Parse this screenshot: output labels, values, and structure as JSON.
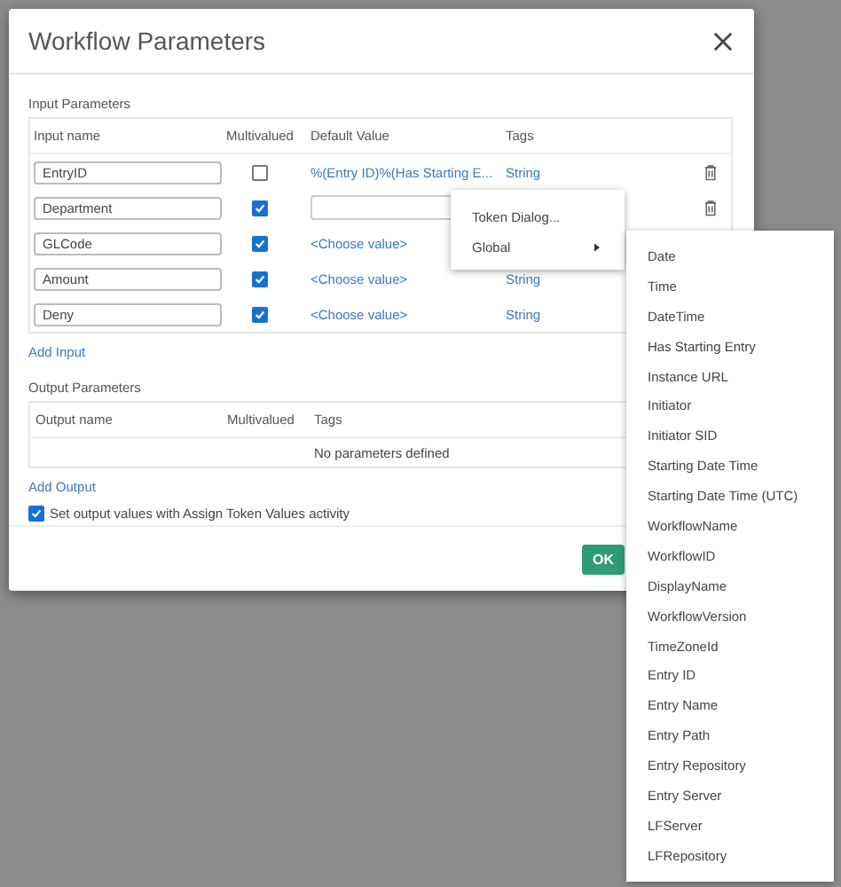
{
  "dialog": {
    "title": "Workflow Parameters",
    "input_parameters": {
      "heading": "Input Parameters",
      "columns": [
        "Input name",
        "Multivalued",
        "Default Value",
        "Tags"
      ],
      "rows": [
        {
          "name": "EntryID",
          "multivalued": false,
          "default": {
            "kind": "link",
            "text": "%(Entry ID)%(Has Starting E..."
          },
          "tag": "String",
          "trash": true
        },
        {
          "name": "Department",
          "multivalued": true,
          "default": {
            "kind": "input"
          },
          "trash": true
        },
        {
          "name": "GLCode",
          "multivalued": true,
          "default": {
            "kind": "link",
            "text": "<Choose value>"
          },
          "trash": false
        },
        {
          "name": "Amount",
          "multivalued": true,
          "default": {
            "kind": "link",
            "text": "<Choose value>"
          },
          "tag": "String",
          "trash": false
        },
        {
          "name": "Deny",
          "multivalued": true,
          "default": {
            "kind": "link",
            "text": "<Choose value>"
          },
          "tag": "String",
          "trash": false
        }
      ],
      "add_link": "Add Input"
    },
    "output_parameters": {
      "heading": "Output Parameters",
      "columns": [
        "Output name",
        "Multivalued",
        "Tags"
      ],
      "empty_text": "No parameters defined",
      "add_link": "Add Output"
    },
    "assign_option": {
      "label": "Set output values with Assign Token Values activity",
      "checked": true
    },
    "ok_button": "OK"
  },
  "context_menu": {
    "items": [
      {
        "label": "Token Dialog...",
        "submenu": false
      },
      {
        "label": "Global",
        "submenu": true
      }
    ]
  },
  "submenu": {
    "items": [
      "Date",
      "Time",
      "DateTime",
      "Has Starting Entry",
      "Instance URL",
      "Initiator",
      "Initiator SID",
      "Starting Date Time",
      "Starting Date Time (UTC)",
      "WorkflowName",
      "WorkflowID",
      "DisplayName",
      "WorkflowVersion",
      "TimeZoneId",
      "Entry ID",
      "Entry Name",
      "Entry Path",
      "Entry Repository",
      "Entry Server",
      "LFServer",
      "LFRepository"
    ]
  }
}
